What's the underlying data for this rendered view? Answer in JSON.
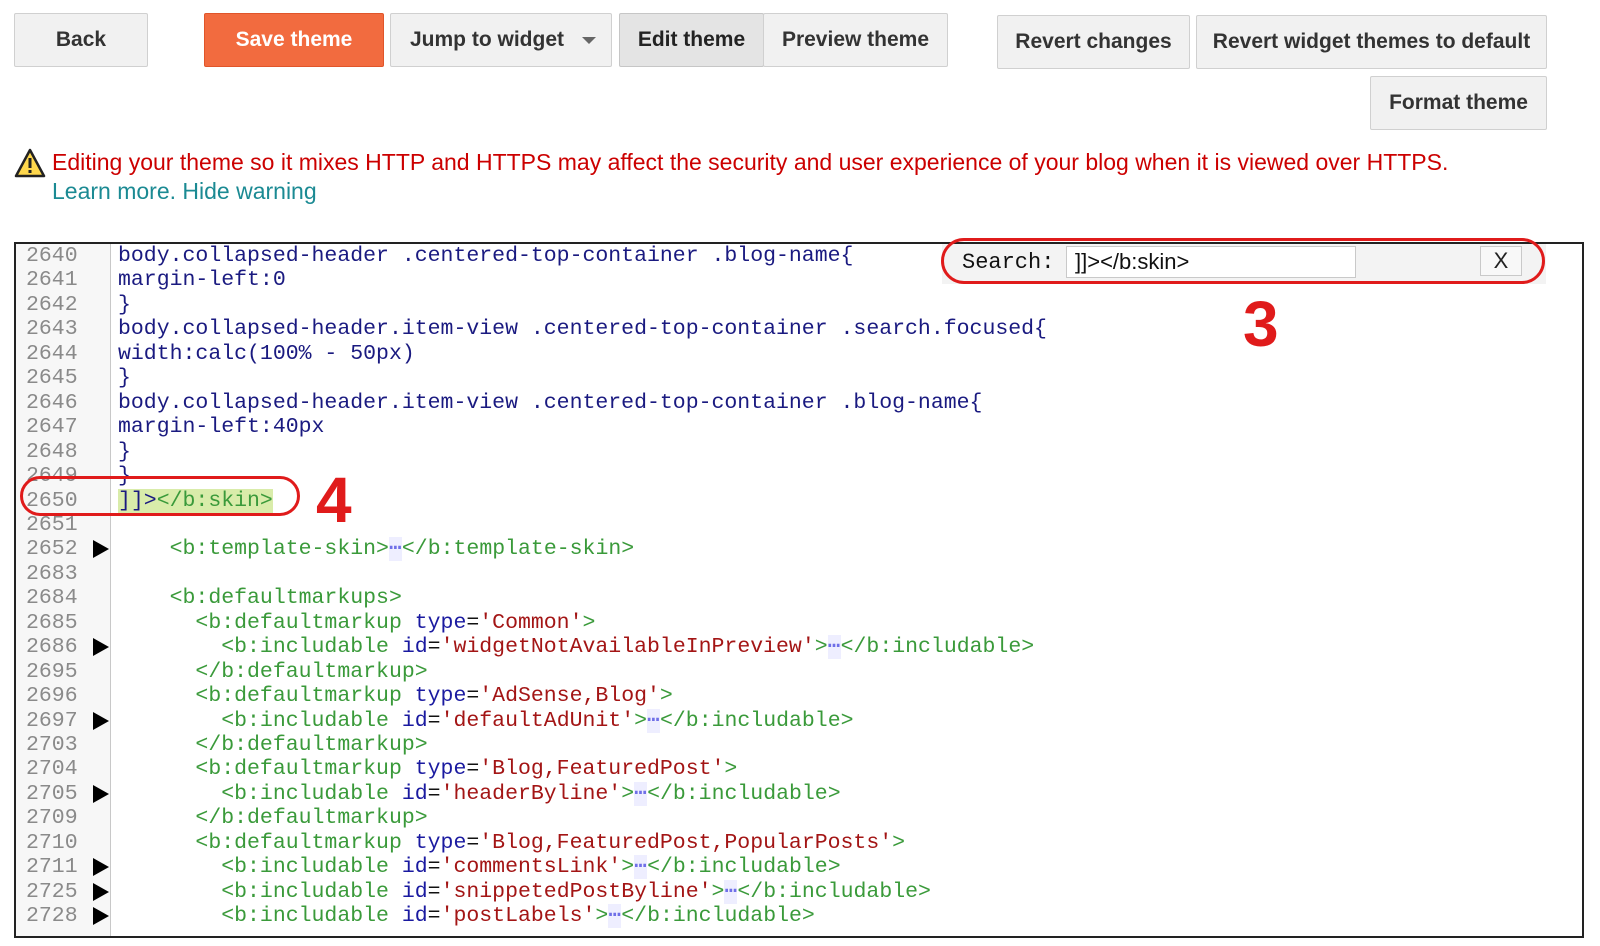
{
  "toolbar": {
    "back_label": "Back",
    "save_label": "Save theme",
    "jump_label": "Jump to widget",
    "edit_label": "Edit theme",
    "preview_label": "Preview theme",
    "revert_label": "Revert changes",
    "revert_widgets_label": "Revert widget themes to default",
    "format_label": "Format theme"
  },
  "warning": {
    "message": "Editing your theme so it mixes HTTP and HTTPS may affect the security and user experience of your blog when it is viewed over HTTPS.",
    "learn_more": "Learn more.",
    "hide": "Hide warning",
    "icon": "warning-triangle-icon"
  },
  "search": {
    "label": "Search:",
    "value": "]]></b:skin>",
    "close_label": "X"
  },
  "annotations": {
    "search_marker": "3",
    "match_marker": "4",
    "color": "#e01b1b"
  },
  "editor": {
    "lines": [
      {
        "n": "2640",
        "fold": false,
        "parts": [
          [
            "navy",
            "body.collapsed-header .centered-top-container .blog-name{"
          ]
        ]
      },
      {
        "n": "2641",
        "fold": false,
        "parts": [
          [
            "navy",
            "margin-left:0"
          ]
        ]
      },
      {
        "n": "2642",
        "fold": false,
        "parts": [
          [
            "navy",
            "}"
          ]
        ]
      },
      {
        "n": "2643",
        "fold": false,
        "parts": [
          [
            "navy",
            "body.collapsed-header.item-view .centered-top-container .search.focused{"
          ]
        ]
      },
      {
        "n": "2644",
        "fold": false,
        "parts": [
          [
            "navy",
            "width:calc(100% - 50px)"
          ]
        ]
      },
      {
        "n": "2645",
        "fold": false,
        "parts": [
          [
            "navy",
            "}"
          ]
        ]
      },
      {
        "n": "2646",
        "fold": false,
        "parts": [
          [
            "navy",
            "body.collapsed-header.item-view .centered-top-container .blog-name{"
          ]
        ]
      },
      {
        "n": "2647",
        "fold": false,
        "parts": [
          [
            "navy",
            "margin-left:40px"
          ]
        ]
      },
      {
        "n": "2648",
        "fold": false,
        "parts": [
          [
            "navy",
            "}"
          ]
        ]
      },
      {
        "n": "2649",
        "fold": false,
        "parts": [
          [
            "navy",
            "}"
          ]
        ]
      },
      {
        "n": "2650",
        "fold": false,
        "highlight": true,
        "parts": [
          [
            "navy",
            "]]>"
          ],
          [
            "green",
            "</b:skin>"
          ]
        ]
      },
      {
        "n": "2651",
        "fold": false,
        "parts": []
      },
      {
        "n": "2652",
        "fold": true,
        "parts": [
          [
            "green",
            "    <b:template-skin>"
          ],
          [
            "dots",
            "⋯"
          ],
          [
            "green",
            "</b:template-skin>"
          ]
        ]
      },
      {
        "n": "2683",
        "fold": false,
        "parts": []
      },
      {
        "n": "2684",
        "fold": false,
        "parts": [
          [
            "green",
            "    <b:defaultmarkups>"
          ]
        ]
      },
      {
        "n": "2685",
        "fold": false,
        "parts": [
          [
            "green",
            "      <b:defaultmarkup "
          ],
          [
            "blue",
            "type"
          ],
          [
            "black",
            "="
          ],
          [
            "red",
            "'Common'"
          ],
          [
            "green",
            ">"
          ]
        ]
      },
      {
        "n": "2686",
        "fold": true,
        "parts": [
          [
            "green",
            "        <b:includable "
          ],
          [
            "blue",
            "id"
          ],
          [
            "black",
            "="
          ],
          [
            "red",
            "'widgetNotAvailableInPreview'"
          ],
          [
            "green",
            ">"
          ],
          [
            "dots",
            "⋯"
          ],
          [
            "green",
            "</b:includable>"
          ]
        ]
      },
      {
        "n": "2695",
        "fold": false,
        "parts": [
          [
            "green",
            "      </b:defaultmarkup>"
          ]
        ]
      },
      {
        "n": "2696",
        "fold": false,
        "parts": [
          [
            "green",
            "      <b:defaultmarkup "
          ],
          [
            "blue",
            "type"
          ],
          [
            "black",
            "="
          ],
          [
            "red",
            "'AdSense,Blog'"
          ],
          [
            "green",
            ">"
          ]
        ]
      },
      {
        "n": "2697",
        "fold": true,
        "parts": [
          [
            "green",
            "        <b:includable "
          ],
          [
            "blue",
            "id"
          ],
          [
            "black",
            "="
          ],
          [
            "red",
            "'defaultAdUnit'"
          ],
          [
            "green",
            ">"
          ],
          [
            "dots",
            "⋯"
          ],
          [
            "green",
            "</b:includable>"
          ]
        ]
      },
      {
        "n": "2703",
        "fold": false,
        "parts": [
          [
            "green",
            "      </b:defaultmarkup>"
          ]
        ]
      },
      {
        "n": "2704",
        "fold": false,
        "parts": [
          [
            "green",
            "      <b:defaultmarkup "
          ],
          [
            "blue",
            "type"
          ],
          [
            "black",
            "="
          ],
          [
            "red",
            "'Blog,FeaturedPost'"
          ],
          [
            "green",
            ">"
          ]
        ]
      },
      {
        "n": "2705",
        "fold": true,
        "parts": [
          [
            "green",
            "        <b:includable "
          ],
          [
            "blue",
            "id"
          ],
          [
            "black",
            "="
          ],
          [
            "red",
            "'headerByline'"
          ],
          [
            "green",
            ">"
          ],
          [
            "dots",
            "⋯"
          ],
          [
            "green",
            "</b:includable>"
          ]
        ]
      },
      {
        "n": "2709",
        "fold": false,
        "parts": [
          [
            "green",
            "      </b:defaultmarkup>"
          ]
        ]
      },
      {
        "n": "2710",
        "fold": false,
        "parts": [
          [
            "green",
            "      <b:defaultmarkup "
          ],
          [
            "blue",
            "type"
          ],
          [
            "black",
            "="
          ],
          [
            "red",
            "'Blog,FeaturedPost,PopularPosts'"
          ],
          [
            "green",
            ">"
          ]
        ]
      },
      {
        "n": "2711",
        "fold": true,
        "parts": [
          [
            "green",
            "        <b:includable "
          ],
          [
            "blue",
            "id"
          ],
          [
            "black",
            "="
          ],
          [
            "red",
            "'commentsLink'"
          ],
          [
            "green",
            ">"
          ],
          [
            "dots",
            "⋯"
          ],
          [
            "green",
            "</b:includable>"
          ]
        ]
      },
      {
        "n": "2725",
        "fold": true,
        "parts": [
          [
            "green",
            "        <b:includable "
          ],
          [
            "blue",
            "id"
          ],
          [
            "black",
            "="
          ],
          [
            "red",
            "'snippetedPostByline'"
          ],
          [
            "green",
            ">"
          ],
          [
            "dots",
            "⋯"
          ],
          [
            "green",
            "</b:includable>"
          ]
        ]
      },
      {
        "n": "2728",
        "fold": true,
        "parts": [
          [
            "green",
            "        <b:includable "
          ],
          [
            "blue",
            "id"
          ],
          [
            "black",
            "="
          ],
          [
            "red",
            "'postLabels'"
          ],
          [
            "green",
            ">"
          ],
          [
            "dots",
            "⋯"
          ],
          [
            "green",
            "</b:includable>"
          ]
        ]
      }
    ]
  }
}
